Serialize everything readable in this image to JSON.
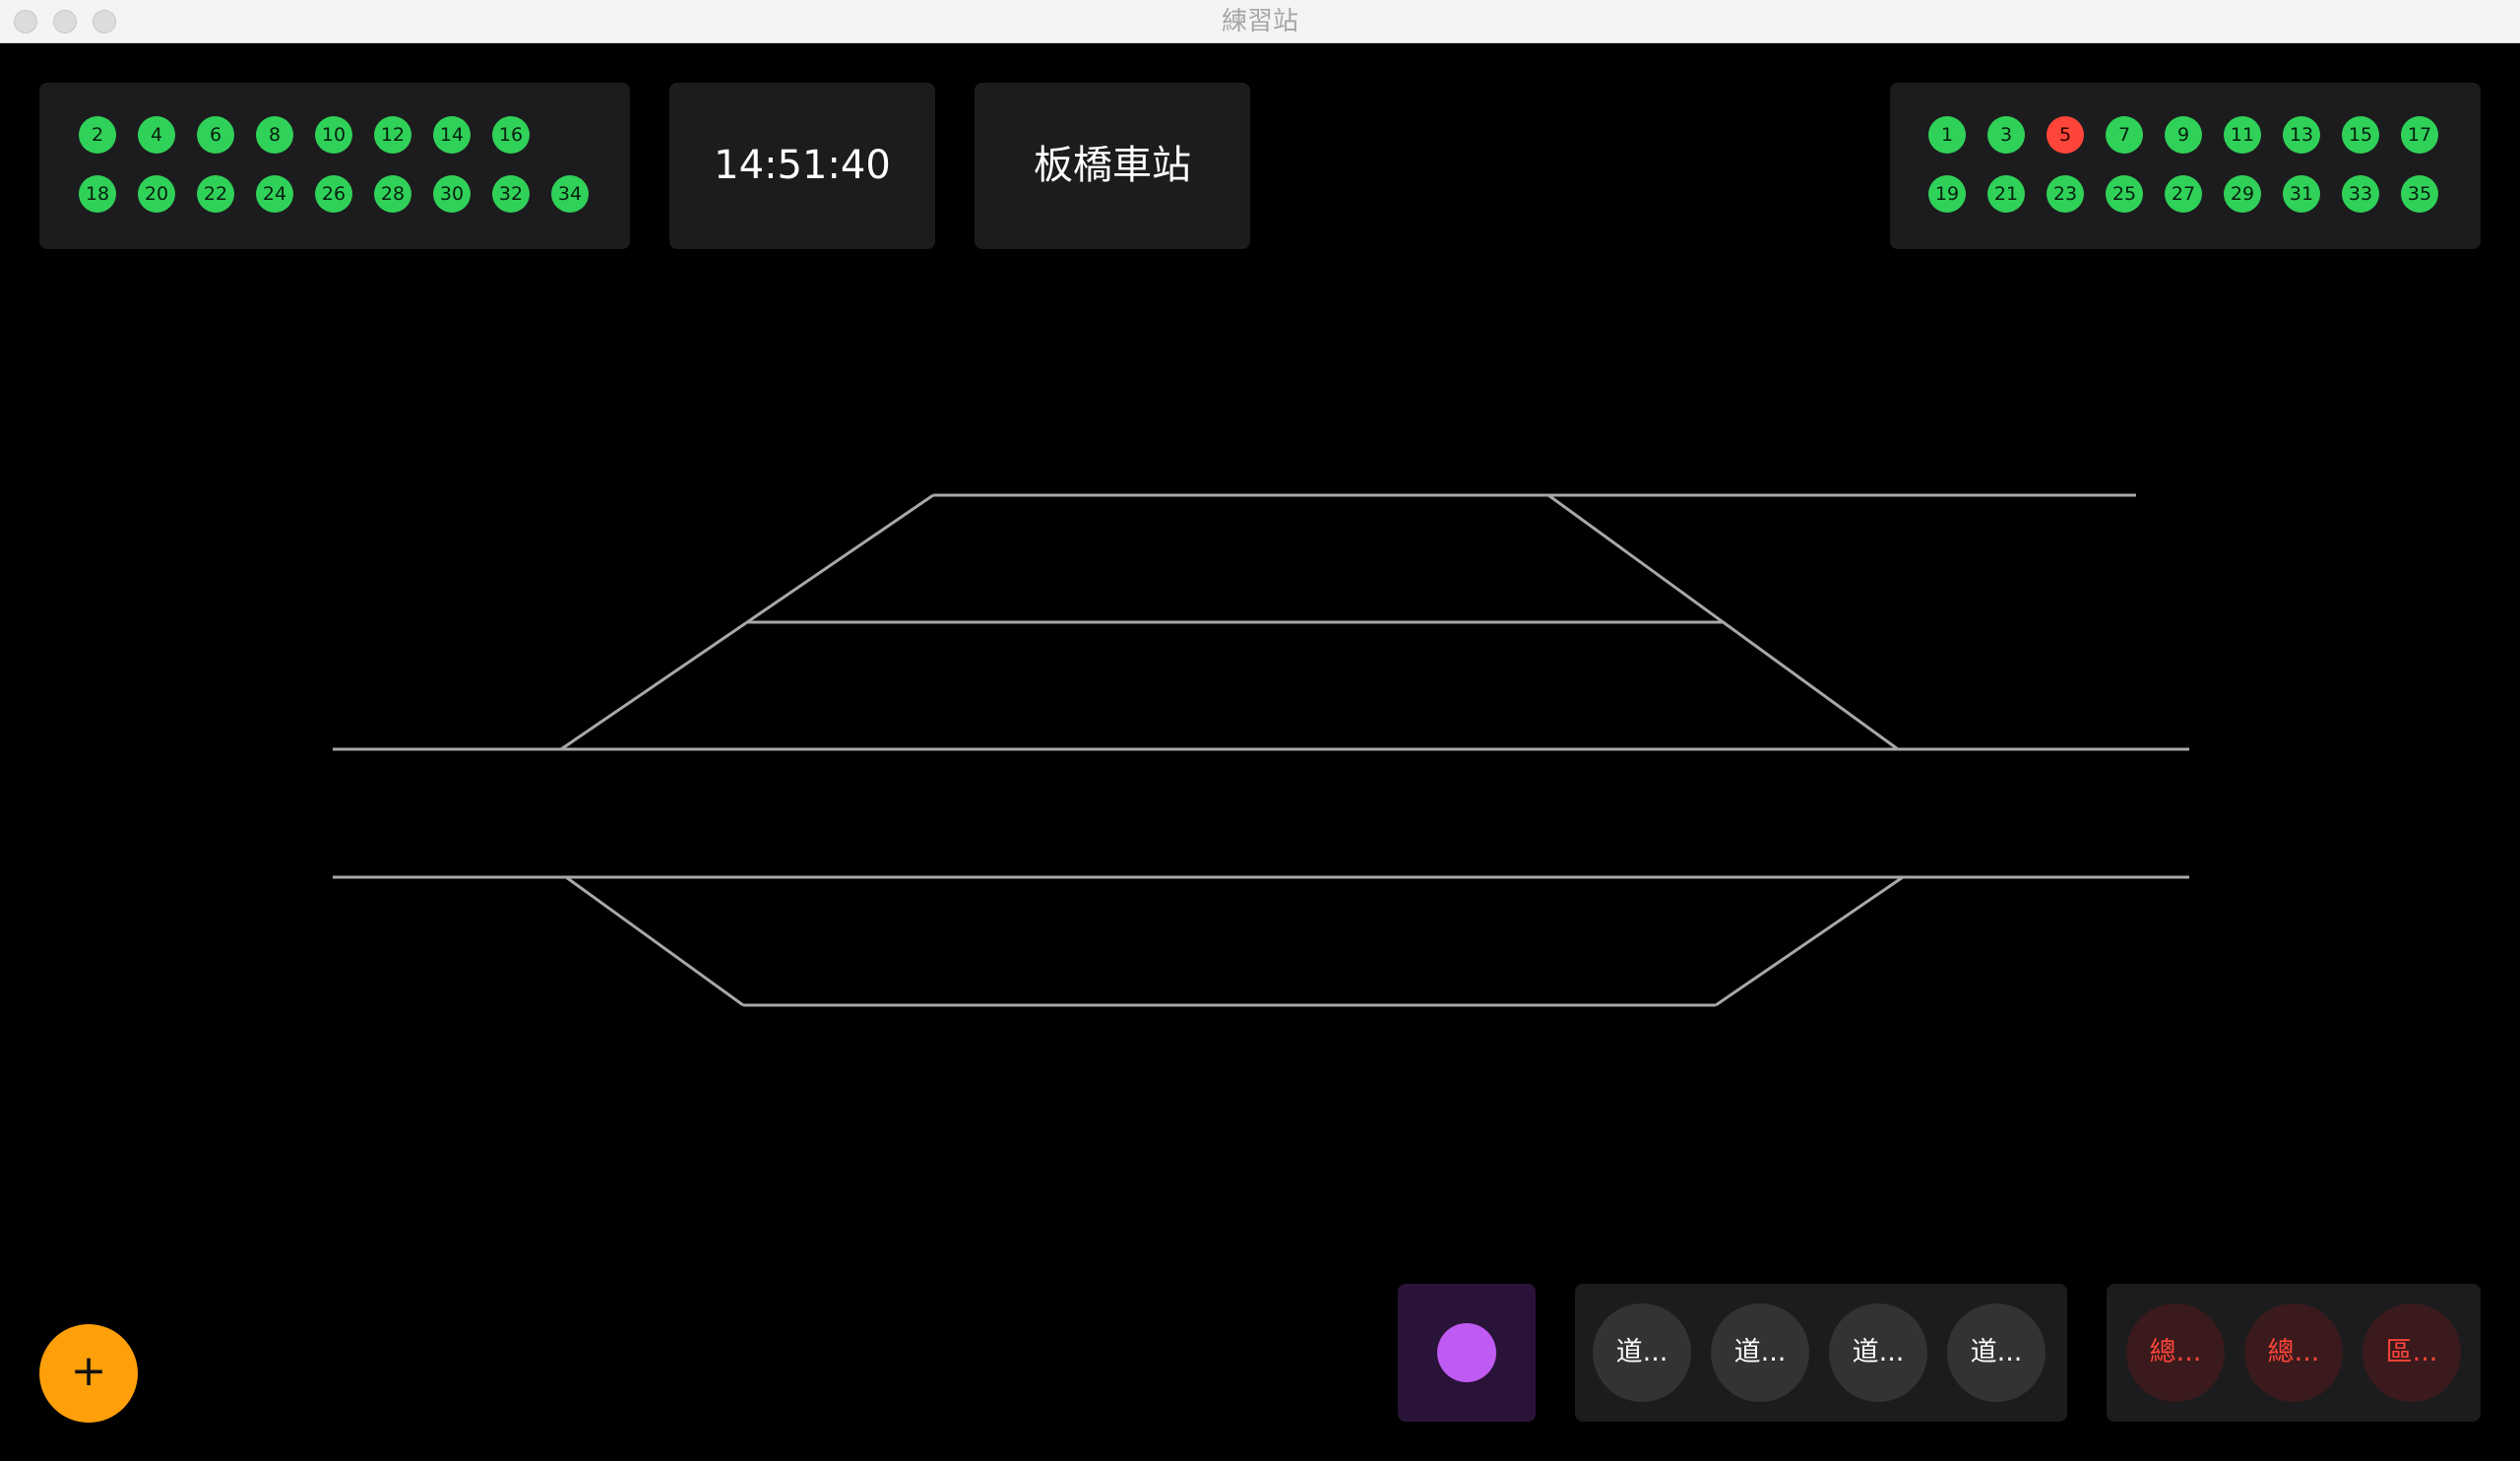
{
  "window": {
    "title": "練習站"
  },
  "even_signals": [
    "2",
    "4",
    "6",
    "8",
    "10",
    "12",
    "14",
    "16",
    "18",
    "20",
    "22",
    "24",
    "26",
    "28",
    "30",
    "32",
    "34"
  ],
  "odd_signals": [
    "1",
    "3",
    "5",
    "7",
    "9",
    "11",
    "13",
    "15",
    "17",
    "19",
    "21",
    "23",
    "25",
    "27",
    "29",
    "31",
    "33",
    "35"
  ],
  "odd_active_red": [
    "5"
  ],
  "clock": {
    "time": "14:51:40"
  },
  "station": {
    "name": "板橋車站"
  },
  "track_buttons": [
    "道...",
    "道...",
    "道...",
    "道..."
  ],
  "danger_buttons": [
    "總...",
    "總...",
    "區..."
  ],
  "add_button": {
    "label": "+"
  },
  "colors": {
    "signal_green": "#30d158",
    "signal_red": "#ff453a",
    "accent_orange": "#ff9f0a",
    "accent_purple": "#bf5af2",
    "track": "#a8a8a8"
  }
}
